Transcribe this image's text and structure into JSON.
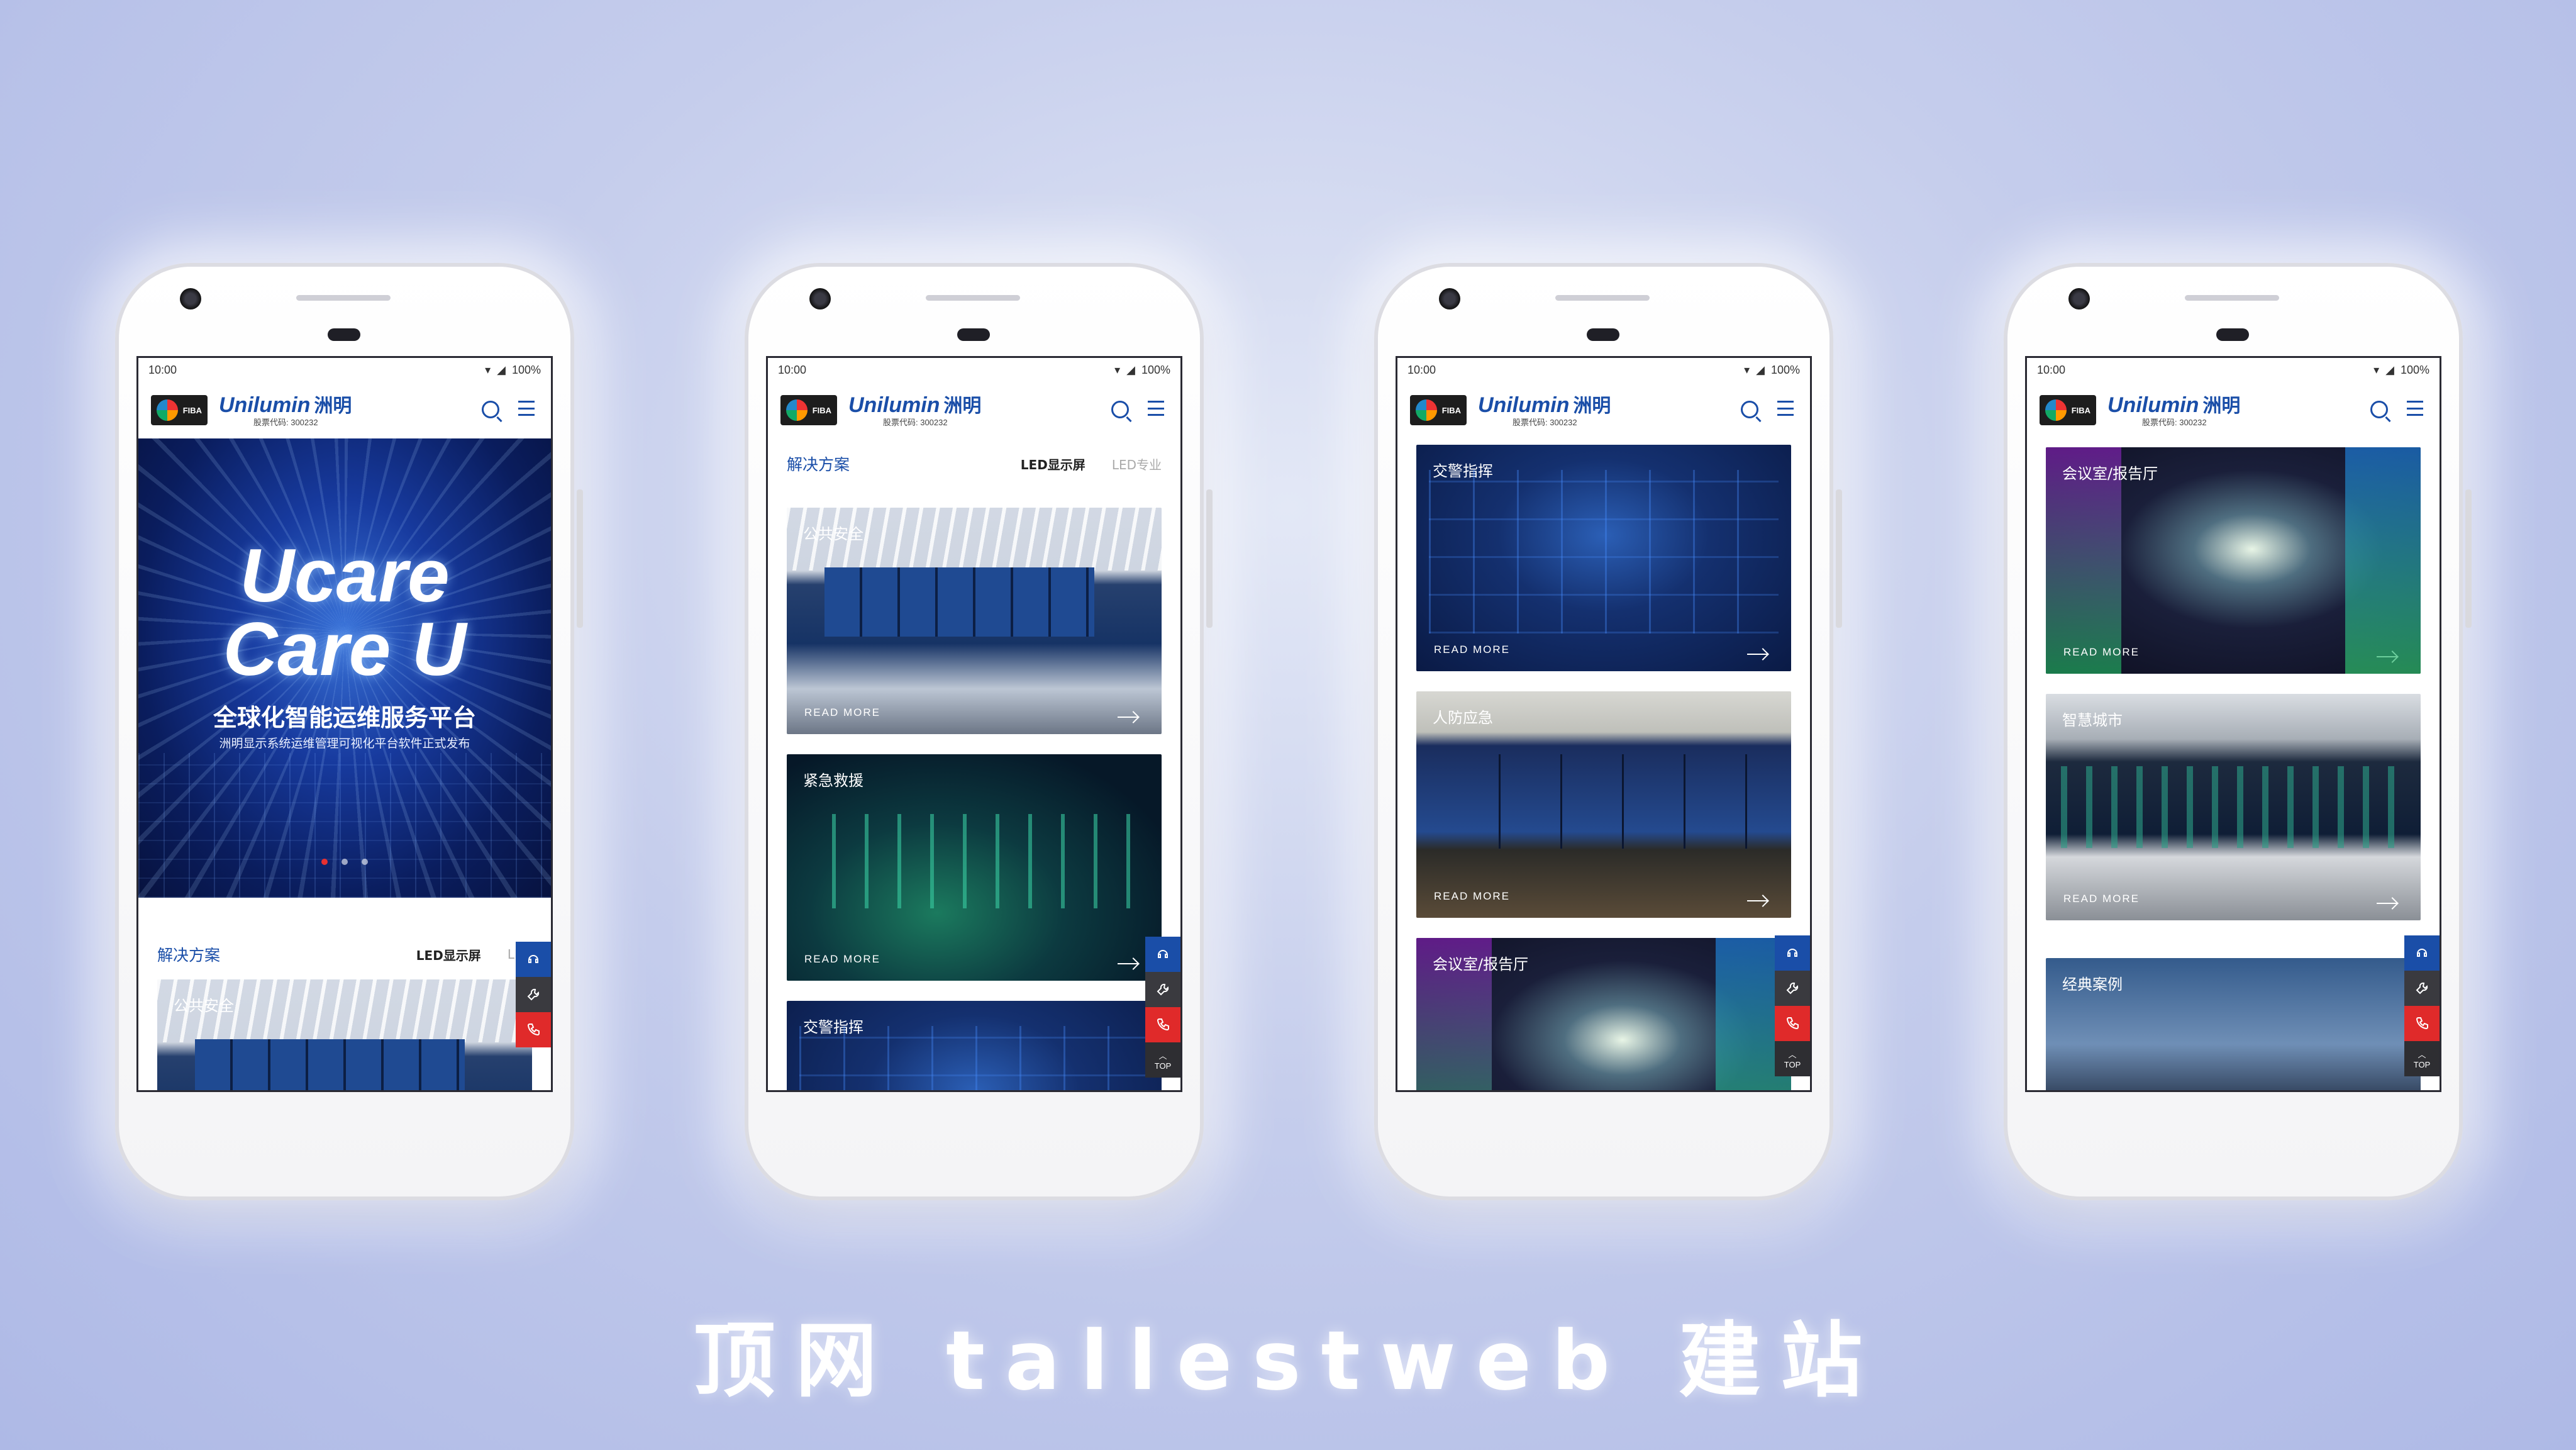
{
  "status": {
    "time": "10:00",
    "battery": "100%"
  },
  "header": {
    "fiba": "FIBA",
    "brand_latin": "Unilumin",
    "brand_cn": "洲明",
    "stock_code": "股票代码: 300232"
  },
  "hero": {
    "title_line1": "Ucare",
    "title_line2": "Care U",
    "headline": "全球化智能运维服务平台",
    "subline": "洲明显示系统运维管理可视化平台软件正式发布"
  },
  "tabs": {
    "section": "解决方案",
    "tab1": "LED显示屏",
    "tab2_p1": "LED",
    "tab2_p2": "LED专业"
  },
  "read_more": "READ MORE",
  "top_label": "TOP",
  "cards": {
    "public_security": "公共安全",
    "emergency": "紧急救援",
    "traffic": "交警指挥",
    "civil_defense": "人防应急",
    "conference": "会议室/报告厅",
    "smart_city": "智慧城市",
    "cases": "经典案例"
  },
  "footer": {
    "caption": "顶网 tallestweb 建站"
  },
  "colors": {
    "brand_blue": "#1a4ea8",
    "accent_red": "#e02a2a"
  },
  "icons": [
    "wifi-icon",
    "signal-icon",
    "search-icon",
    "menu-icon",
    "headset-icon",
    "wrench-icon",
    "phone-icon",
    "up-arrow-icon",
    "arrow-right-icon"
  ]
}
